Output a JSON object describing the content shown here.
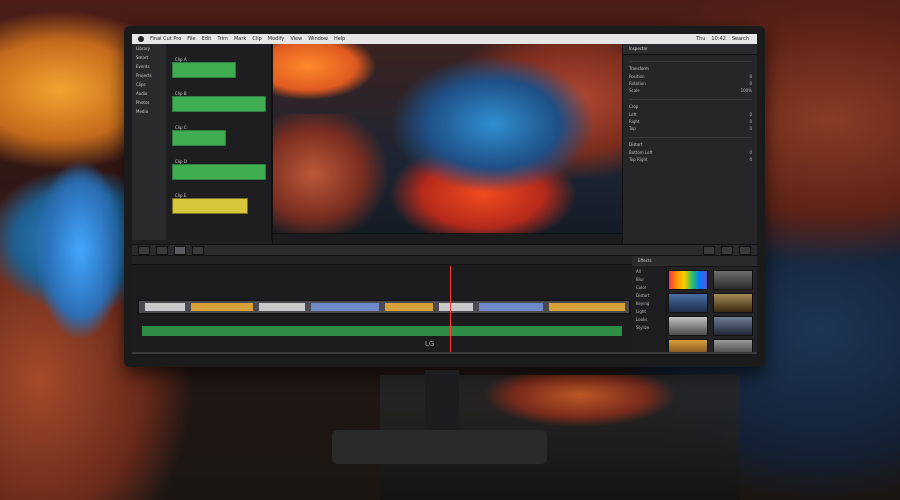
{
  "menubar": {
    "app_name": "Final Cut Pro",
    "items": [
      "File",
      "Edit",
      "Trim",
      "Mark",
      "Clip",
      "Modify",
      "View",
      "Window",
      "Help"
    ],
    "right_items": [
      "Thu",
      "10:42",
      "Search"
    ]
  },
  "libraries": {
    "rows": [
      "Library",
      "Smart",
      "Events",
      "Projects",
      "Clips",
      "Audio",
      "Photos",
      "Media"
    ]
  },
  "browser": {
    "clips": [
      "Clip A",
      "Clip B",
      "Clip C",
      "Clip D",
      "Clip E"
    ]
  },
  "inspector": {
    "title": "Inspector",
    "sections": [
      {
        "name": "Transform",
        "lines": [
          [
            "Position",
            "0"
          ],
          [
            "Rotation",
            "0"
          ],
          [
            "Scale",
            "100%"
          ]
        ]
      },
      {
        "name": "Crop",
        "lines": [
          [
            "Left",
            "0"
          ],
          [
            "Right",
            "0"
          ],
          [
            "Top",
            "0"
          ]
        ]
      },
      {
        "name": "Distort",
        "lines": [
          [
            "Bottom Left",
            "0"
          ],
          [
            "Top Right",
            "0"
          ]
        ]
      }
    ]
  },
  "effects": {
    "header": "Effects",
    "categories": [
      "All",
      "Blur",
      "Color",
      "Distort",
      "Keying",
      "Light",
      "Looks",
      "Stylize"
    ]
  },
  "colors": {
    "accent_green": "#3fae53",
    "playhead": "#ff3b30",
    "gold": "#d8a23a"
  }
}
